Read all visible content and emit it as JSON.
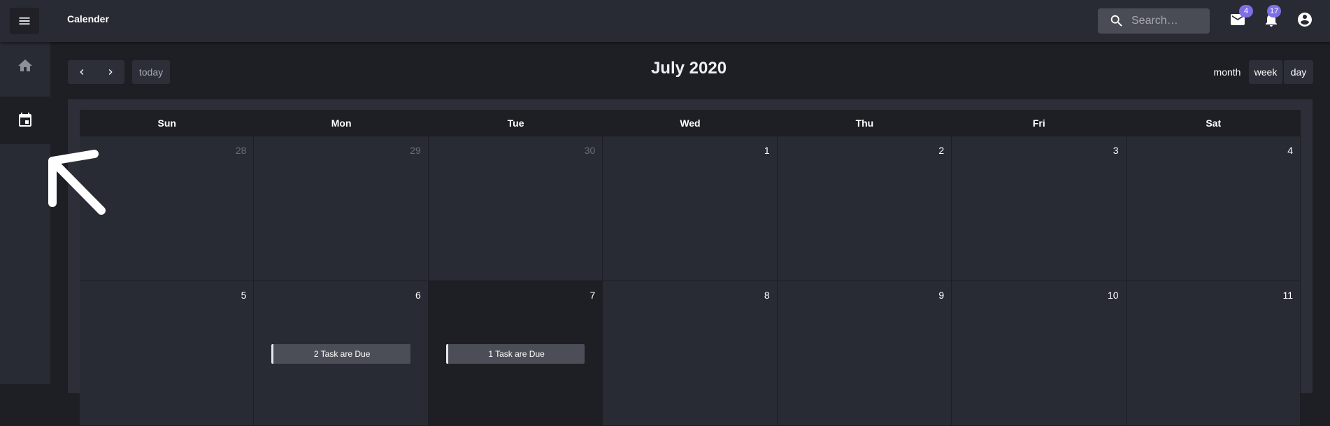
{
  "app": {
    "title": "Calender"
  },
  "header": {
    "menu_icon": "menu-icon",
    "search": {
      "placeholder": "Search…",
      "icon": "search-icon"
    },
    "mail": {
      "icon": "mail-icon",
      "badge": "4"
    },
    "notifications": {
      "icon": "bell-icon",
      "badge": "17"
    },
    "account": {
      "icon": "account-circle-icon"
    }
  },
  "sidebar": {
    "items": [
      {
        "id": "home",
        "icon": "home-icon",
        "active": false
      },
      {
        "id": "calendar",
        "icon": "calendar-icon",
        "active": true
      }
    ]
  },
  "calendar": {
    "title": "July 2020",
    "toolbar": {
      "prev_icon": "chevron-left-icon",
      "next_icon": "chevron-right-icon",
      "today_label": "today",
      "views": [
        "month",
        "week",
        "day"
      ],
      "active_view": "month"
    },
    "weekdays": [
      "Sun",
      "Mon",
      "Tue",
      "Wed",
      "Thu",
      "Fri",
      "Sat"
    ],
    "weeks": [
      [
        {
          "day": "28",
          "other_month": true
        },
        {
          "day": "29",
          "other_month": true
        },
        {
          "day": "30",
          "other_month": true
        },
        {
          "day": "1"
        },
        {
          "day": "2"
        },
        {
          "day": "3"
        },
        {
          "day": "4"
        }
      ],
      [
        {
          "day": "5"
        },
        {
          "day": "6",
          "event": "2 Task are Due"
        },
        {
          "day": "7",
          "today": true,
          "event": "1 Task are Due"
        },
        {
          "day": "8"
        },
        {
          "day": "9"
        },
        {
          "day": "10"
        },
        {
          "day": "11"
        }
      ]
    ]
  },
  "colors": {
    "background": "#1d1f24",
    "bar": "#282b34",
    "badge": "#7e6fe6",
    "event": "#4b4e57"
  }
}
